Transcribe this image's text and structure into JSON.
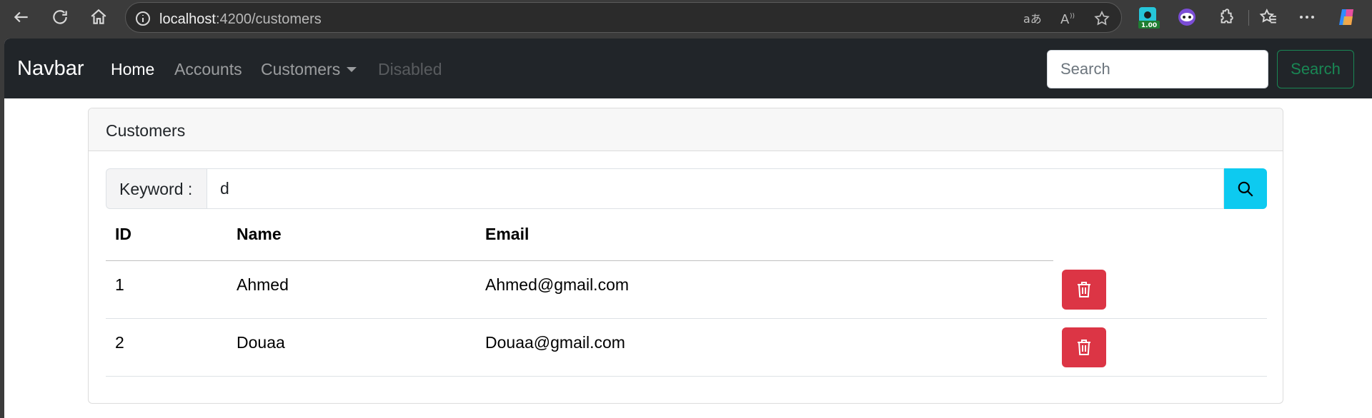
{
  "browser": {
    "url_host": "localhost",
    "url_rest": ":4200/customers",
    "extension_badge": "1.00"
  },
  "navbar": {
    "brand": "Navbar",
    "links": [
      {
        "label": "Home",
        "state": "active"
      },
      {
        "label": "Accounts",
        "state": "normal"
      },
      {
        "label": "Customers",
        "state": "dropdown"
      },
      {
        "label": "Disabled",
        "state": "disabled"
      }
    ],
    "search_placeholder": "Search",
    "search_button": "Search"
  },
  "card": {
    "title": "Customers",
    "keyword_label": "Keyword :",
    "keyword_value": "d",
    "search_icon": "search-icon"
  },
  "table": {
    "headers": [
      "ID",
      "Name",
      "Email"
    ],
    "rows": [
      {
        "id": "1",
        "name": "Ahmed",
        "email": "Ahmed@gmail.com"
      },
      {
        "id": "2",
        "name": "Douaa",
        "email": "Douaa@gmail.com"
      }
    ],
    "delete_icon": "trash-icon"
  },
  "colors": {
    "navbar_bg": "#212529",
    "success": "#198754",
    "info": "#0dcaf0",
    "danger": "#dc3545"
  }
}
